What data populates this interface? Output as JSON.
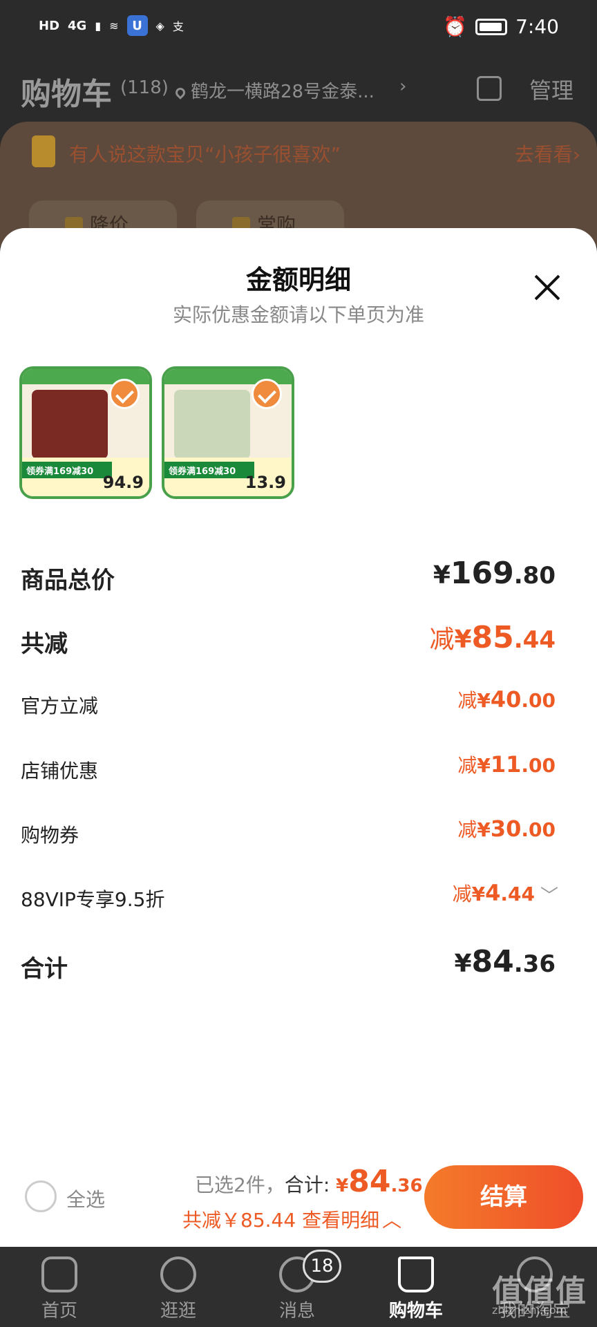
{
  "status_bar": {
    "left_chips": [
      "HD",
      "4G"
    ],
    "time": "7:40"
  },
  "header": {
    "title": "购物车",
    "count": "(118)",
    "address": "鹤龙一横路28号金泰...",
    "manage_label": "管理"
  },
  "background": {
    "promo_text": "有人说这款宝贝“小孩子很喜欢”",
    "promo_link": "去看看›",
    "filters": [
      "降价",
      "常购"
    ]
  },
  "sheet": {
    "title": "金额明细",
    "subtitle": "实际优惠金额请以下单页为准",
    "products": [
      {
        "coupon": "领券满169减30",
        "price": "94.9"
      },
      {
        "coupon": "领券满169减30",
        "price": "13.9"
      }
    ],
    "rows": {
      "total_price": {
        "label": "商品总价",
        "currency": "¥",
        "int": "169",
        "dec": ".80"
      },
      "total_discount": {
        "label": "共减",
        "prefix": "减",
        "currency": "¥",
        "int": "85",
        "dec": ".44"
      },
      "official": {
        "label": "官方立减",
        "prefix": "减",
        "currency": "¥",
        "int": "40",
        "dec": ".00"
      },
      "store": {
        "label": "店铺优惠",
        "prefix": "减",
        "currency": "¥",
        "int": "11",
        "dec": ".00"
      },
      "voucher": {
        "label": "购物券",
        "prefix": "减",
        "currency": "¥",
        "int": "30",
        "dec": ".00"
      },
      "vip": {
        "label": "88VIP专享9.5折",
        "prefix": "减",
        "currency": "¥",
        "int": "4",
        "dec": ".44"
      },
      "sum": {
        "label": "合计",
        "currency": "¥",
        "int": "84",
        "dec": ".36"
      }
    }
  },
  "checkout": {
    "select_all": "全选",
    "selected_text": "已选2件，",
    "total_label": "合计: ",
    "total_currency": "¥",
    "total_int": "84",
    "total_dec": ".36",
    "discount_text": "共减￥85.44",
    "detail_link": "查看明细",
    "button": "结算"
  },
  "tabs": {
    "home": "首页",
    "guang": "逛逛",
    "msg": "消息",
    "msg_badge": "18",
    "cart": "购物车",
    "mine": "我的淘宝"
  },
  "watermark": {
    "main": "值值值",
    "sub": "zhizhizhi.com"
  },
  "colors": {
    "accent": "#ee5a24",
    "checkout_gradient_start": "#f47b2a",
    "checkout_gradient_end": "#ef4e2a"
  }
}
